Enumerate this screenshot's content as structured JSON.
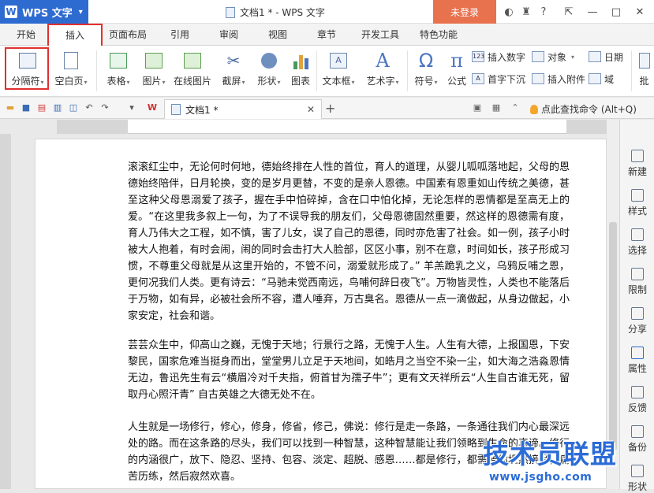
{
  "titlebar": {
    "app": "WPS 文字",
    "doc_title": "文档1 * - WPS 文字",
    "login": "未登录"
  },
  "menu": [
    "开始",
    "插入",
    "页面布局",
    "引用",
    "审阅",
    "视图",
    "章节",
    "开发工具",
    "特色功能"
  ],
  "ribbon": {
    "buttons": [
      "分隔符",
      "空白页",
      "表格",
      "图片",
      "在线图片",
      "截屏",
      "形状",
      "图表",
      "文本框",
      "艺术字",
      "符号",
      "公式"
    ],
    "small": [
      "插入数字",
      "对象",
      "日期",
      "首字下沉",
      "插入附件",
      "域"
    ],
    "right_partial": "批"
  },
  "quickbar": {
    "tab_title": "文档1 *",
    "search": "点此查找命令 (Alt+Q)"
  },
  "document": {
    "paragraphs": [
      "滚滚红尘中，无论何时何地，德始终排在人性的首位，育人的道理，从婴儿呱呱落地起，父母的恩德始终陪伴，日月轮换，变的是岁月更替，不变的是亲人恩德。中国素有恩重如山传统之美德，甚至这种父母恩溺爱了孩子，握在手中怕碎掉，含在口中怕化掉，无论怎样的恩情都是至高无上的爱。“在这里我多叙上一句，为了不误导我的朋友们，父母恩德固然重要，然这样的恩德需有度，育人乃伟大之工程，如不慎，害了儿女，误了自己的恩德，同时亦危害了社会。如一例，孩子小时被大人抱着，有时会闹，闹的同时会击打大人脸部，区区小事，别不在意，时间如长，孩子形成习惯，不尊重父母就是从这里开始的，不管不问，溺爱就形成了。” 羊羔跪乳之义，乌鸦反哺之恩，更何况我们人类。更有诗云：“马驰未觉西南远，鸟哺何辞日夜飞”。万物皆灵性，人类也不能落后于万物，如有异，必被社会所不容，遭人唾弃，万古臭名。恩德从一点一滴做起，从身边做起，小家安定，社会和谐。",
      "芸芸众生中，仰高山之巍，无愧于天地；行景行之路，无愧于人生。人生有大德，上报国恩，下安黎民，国家危难当挺身而出，堂堂男儿立足于天地间，如皓月之当空不染一尘，如大海之浩淼恩情无边，鲁迅先生有云“横眉冷对千夫指，俯首甘为孺子牛”；更有文天祥所云“人生自古谁无死，留取丹心照汗青” 自古英雄之大德无处不在。",
      "人生就是一场修行，修心，修身，修省，修己，佛说：修行是走一条路，一条通往我们内心最深远处的路。而在这条路的尽头，我们可以找到一种智慧，这种智慧能让我们领略到生命的真谛。修行的内涵很广，放下、隐忍、坚持、包容、淡定、超脱、感恩……都是修行，都需要你坦然接受，痛苦历练，然后寂然欢喜。"
    ]
  },
  "right_panel": [
    "新建",
    "样式",
    "选择",
    "限制",
    "分享",
    "属性",
    "反馈",
    "备份",
    "形状"
  ],
  "watermark": {
    "text": "技术员联盟",
    "url": "www.jsgho.com"
  }
}
